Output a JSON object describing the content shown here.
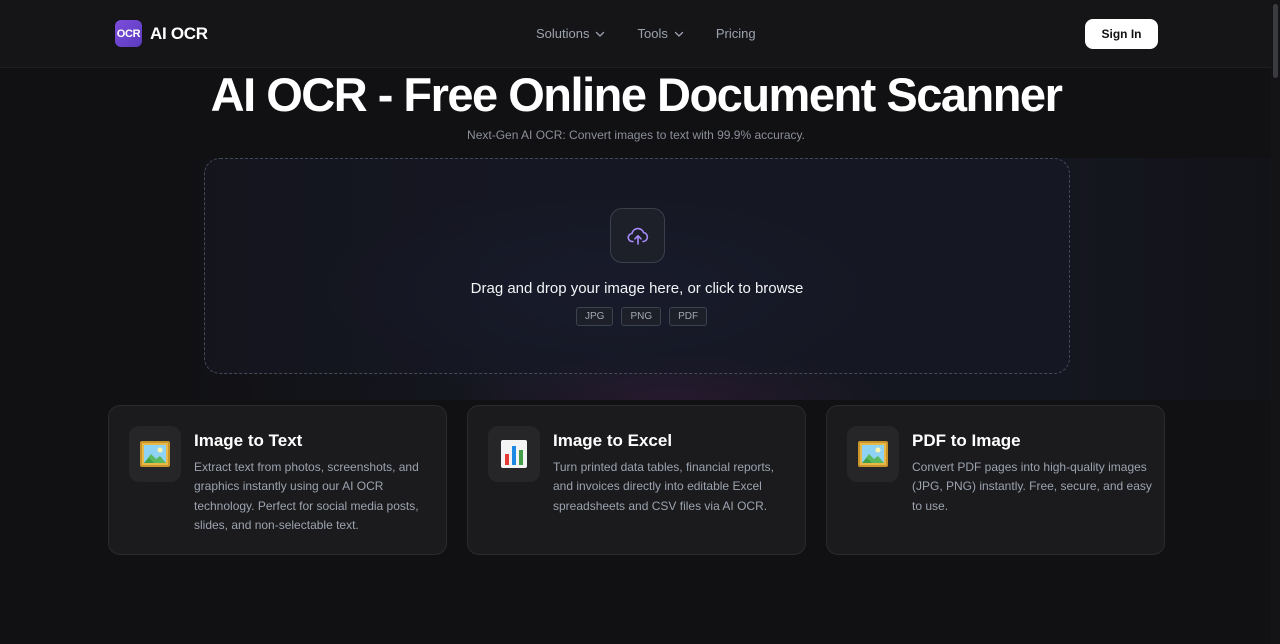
{
  "header": {
    "logo_badge": "OCR",
    "brand_name": "AI OCR",
    "nav": {
      "solutions": "Solutions",
      "tools": "Tools",
      "pricing": "Pricing"
    },
    "sign_in": "Sign In"
  },
  "hero": {
    "title": "AI OCR - Free Online Document Scanner",
    "subtitle": "Next-Gen AI OCR: Convert images to text with 99.9% accuracy."
  },
  "upload": {
    "prompt": "Drag and drop your image here, or click to browse",
    "formats": [
      "JPG",
      "PNG",
      "PDF"
    ],
    "icon": "cloud-upload-icon"
  },
  "cards": [
    {
      "title": "Image to Text",
      "icon": "framed-picture-icon",
      "description": "Extract text from photos, screenshots, and graphics instantly using our AI OCR technology. Perfect for social media posts, slides, and non-selectable text."
    },
    {
      "title": "Image to Excel",
      "icon": "bar-chart-icon",
      "description": "Turn printed data tables, financial reports, and invoices directly into editable Excel spreadsheets and CSV files via AI OCR."
    },
    {
      "title": "PDF to Image",
      "icon": "framed-picture-icon",
      "description": "Convert PDF pages into high-quality images (JPG, PNG) instantly. Free, secure, and easy to use."
    }
  ],
  "colors": {
    "background": "#111114",
    "accent": "#7c4ddb",
    "upload_icon": "#a78bfa"
  }
}
